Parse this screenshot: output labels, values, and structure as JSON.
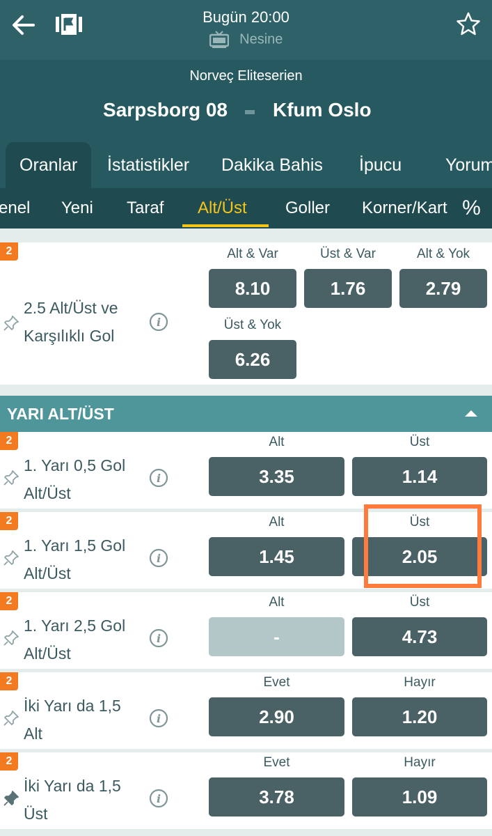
{
  "header": {
    "time": "Bugün 20:00",
    "channel": "Nesine"
  },
  "match": {
    "league": "Norveç Eliteserien",
    "home": "Sarpsborg 08",
    "away": "Kfum Oslo"
  },
  "tabs": [
    "Oranlar",
    "İstatistikler",
    "Dakika Bahis",
    "İpucu",
    "Yorum"
  ],
  "subtabs": [
    "enel",
    "Yeni",
    "Taraf",
    "Alt/Üst",
    "Goller",
    "Korner/Kart"
  ],
  "percent_label": "%",
  "combo_market": {
    "badge": "2",
    "label_line1": "2.5 Alt/Üst ve",
    "label_line2": "Karşılıklı Gol",
    "headers": [
      "Alt & Var",
      "Üst & Var",
      "Alt & Yok",
      "Üst & Yok"
    ],
    "odds": [
      "8.10",
      "1.76",
      "2.79",
      "6.26"
    ]
  },
  "section": {
    "title": "YARI ALT/ÜST"
  },
  "markets": [
    {
      "badge": "2",
      "line1": "1. Yarı 0,5 Gol",
      "line2": "Alt/Üst",
      "h1": "Alt",
      "h2": "Üst",
      "o1": "3.35",
      "o2": "1.14"
    },
    {
      "badge": "2",
      "line1": "1. Yarı 1,5 Gol",
      "line2": "Alt/Üst",
      "h1": "Alt",
      "h2": "Üst",
      "o1": "1.45",
      "o2": "2.05"
    },
    {
      "badge": "2",
      "line1": "1. Yarı 2,5 Gol",
      "line2": "Alt/Üst",
      "h1": "Alt",
      "h2": "Üst",
      "o1": "-",
      "o2": "4.73"
    },
    {
      "badge": "2",
      "line1": "İki Yarı da 1,5",
      "line2": "Alt",
      "h1": "Evet",
      "h2": "Hayır",
      "o1": "2.90",
      "o2": "1.20"
    },
    {
      "badge": "2",
      "line1": "İki Yarı da 1,5",
      "line2": "Üst",
      "h1": "Evet",
      "h2": "Hayır",
      "o1": "3.78",
      "o2": "1.09"
    }
  ],
  "colors": {
    "header": "#2e6268",
    "tabs": "#275a60",
    "subtabs": "#1f4a50",
    "accent": "#f5c518",
    "badge": "#f47a20",
    "odd_button": "#4a6266",
    "section_header": "#4f969b",
    "highlight": "#ff7a3d"
  },
  "icons": [
    "arrow-left-icon",
    "live-stream-icon",
    "star-icon",
    "tv-icon",
    "pin-icon",
    "info-icon",
    "chevron-up-icon"
  ]
}
